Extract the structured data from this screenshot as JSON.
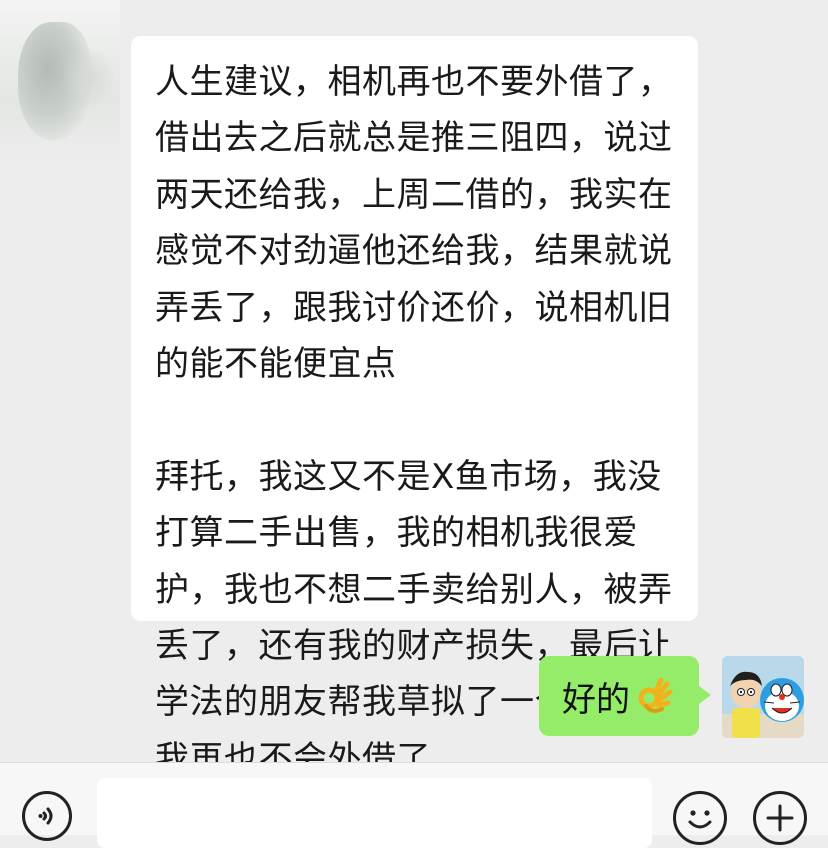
{
  "chat": {
    "incoming_message": {
      "paragraphs": [
        "人生建议，相机再也不要外借了，\n借出去之后就总是推三阻四，说过\n两天还给我，上周二借的，我实在\n感觉不对劲逼他还给我，结果就说\n弄丢了，跟我讨价还价，说相机旧\n的能不能便宜点",
        "拜托，我这又不是Ⅹ鱼市场，我没\n打算二手出售，我的相机我很爱\n护，我也不想二手卖给别人，被弄\n丢了，还有我的财产损失，最后让\n学法的朋友帮我草拟了一个欠条，\n我再也不会外借了"
      ]
    },
    "outgoing_message": {
      "text": "好的",
      "emoji": "ok-hand-icon"
    }
  },
  "input_bar": {
    "input_value": "",
    "voice_icon": "voice-icon",
    "emoji_icon": "emoji-icon",
    "plus_icon": "plus-icon"
  },
  "colors": {
    "background": "#ededed",
    "incoming_bubble": "#ffffff",
    "outgoing_bubble": "#95ec69",
    "input_bar": "#f7f7f7"
  }
}
